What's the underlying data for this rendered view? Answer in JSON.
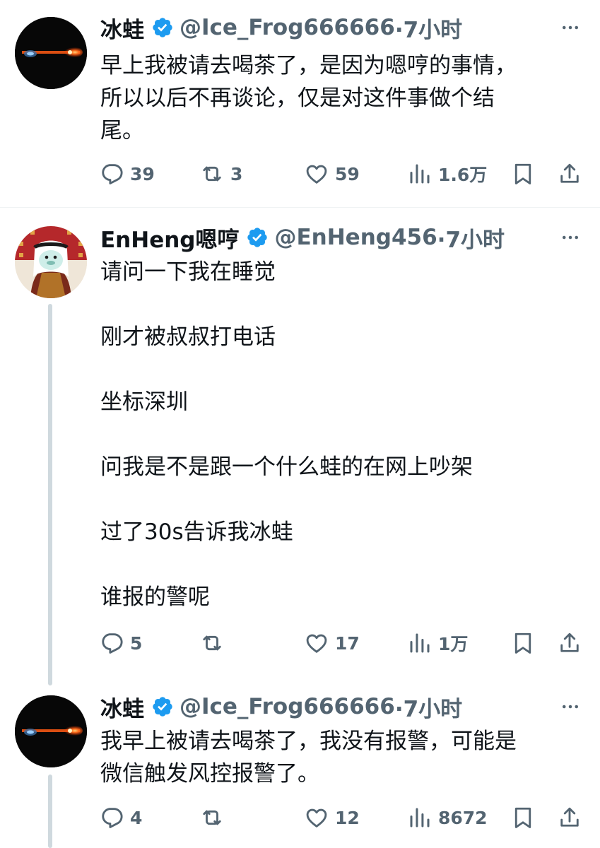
{
  "tweets": [
    {
      "name": "冰蛙",
      "handle": "@Ice_Frog666666",
      "time": "·7小时",
      "lines": [
        "早上我被请去喝茶了，是因为嗯哼的事情，",
        "所以以后不再谈论，仅是对这件事做个结",
        "尾。"
      ],
      "replies": "39",
      "retweets": "3",
      "likes": "59",
      "views": "1.6万"
    },
    {
      "name": "EnHeng嗯哼",
      "handle": "@EnHeng456",
      "time": "·7小时",
      "paragraphs": [
        "请问一下我在睡觉",
        "刚才被叔叔打电话",
        "坐标深圳",
        "问我是不是跟一个什么蛙的在网上吵架",
        "过了30s告诉我冰蛙",
        "谁报的警呢"
      ],
      "replies": "5",
      "retweets": "",
      "likes": "17",
      "views": "1万"
    },
    {
      "name": "冰蛙",
      "handle": "@Ice_Frog666666",
      "time": "·7小时",
      "lines": [
        "我早上被请去喝茶了，我没有报警，可能是",
        "微信触发风控报警了。"
      ],
      "replies": "4",
      "retweets": "",
      "likes": "12",
      "views": "8672"
    }
  ],
  "colors": {
    "verified": "#1d9bf0",
    "muted": "#536471",
    "text": "#0f1419",
    "line": "#cfd9de"
  }
}
